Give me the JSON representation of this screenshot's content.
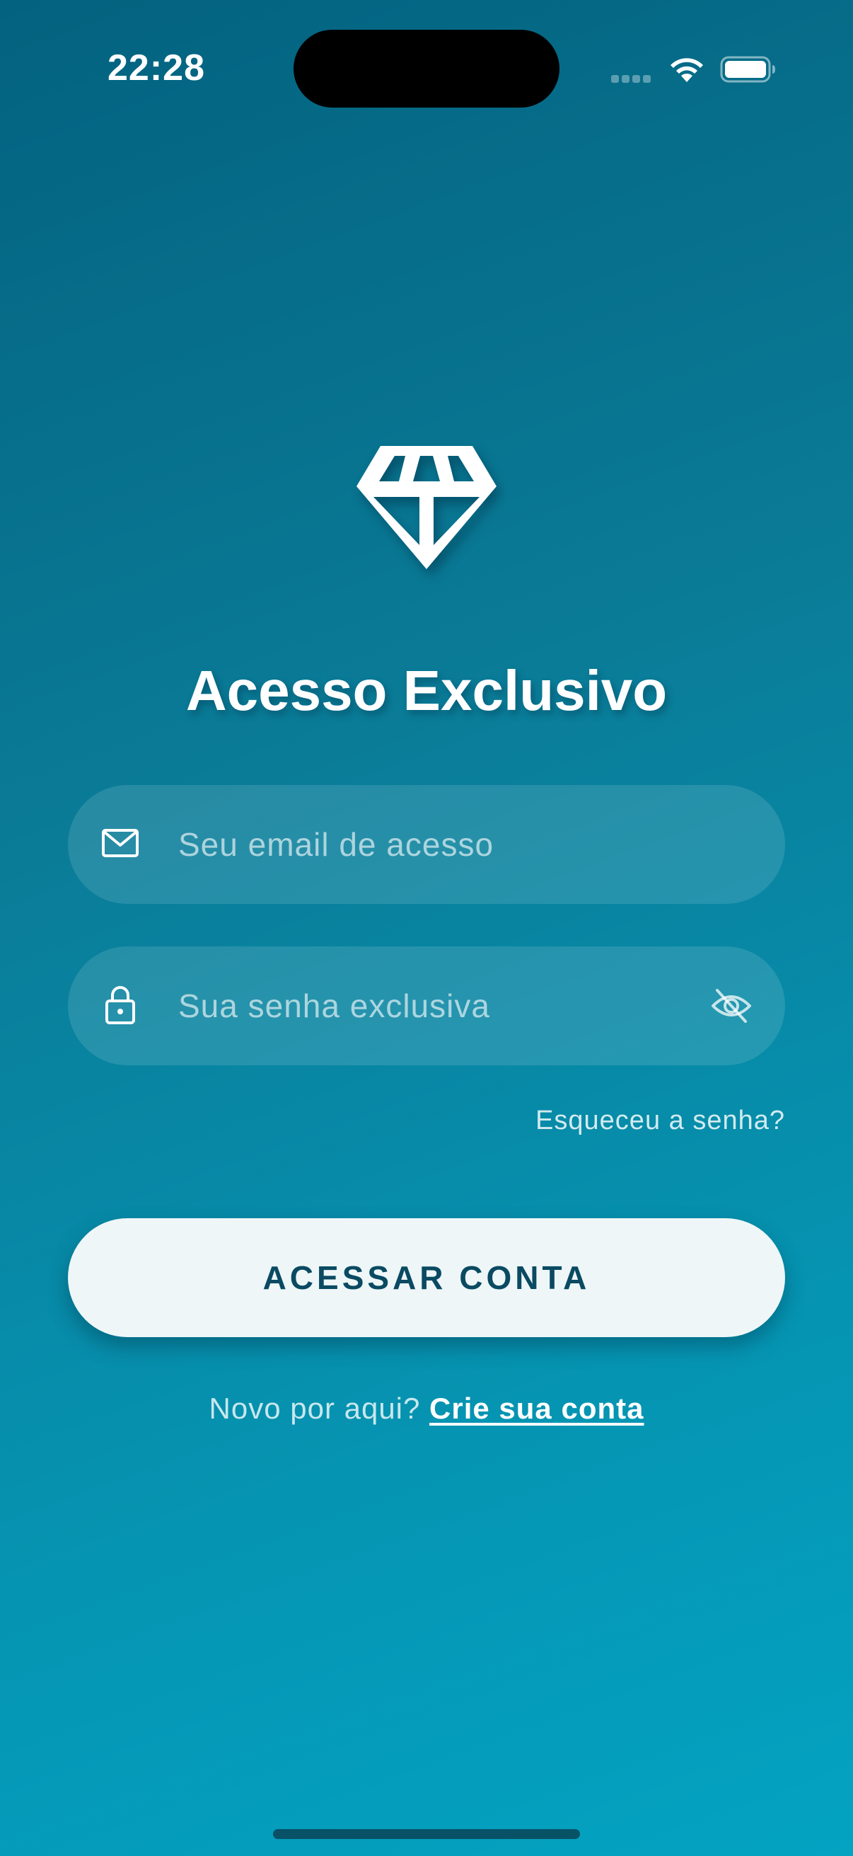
{
  "status_bar": {
    "time": "22:28",
    "icons": [
      "cellular-signal-icon",
      "wifi-icon",
      "battery-icon"
    ]
  },
  "logo": {
    "icon": "diamond-icon"
  },
  "title": "Acesso Exclusivo",
  "email_field": {
    "icon": "envelope-icon",
    "placeholder": "Seu email de acesso",
    "value": ""
  },
  "password_field": {
    "icon": "lock-icon",
    "placeholder": "Sua senha exclusiva",
    "value": "",
    "toggle_icon": "eye-off-icon"
  },
  "forgot_password": "Esqueceu a senha?",
  "submit_button": "ACESSAR CONTA",
  "signup": {
    "prompt": "Novo por aqui?",
    "link": "Crie sua conta"
  },
  "colors": {
    "background_top": "#03627f",
    "background_bottom": "#04a3c2",
    "button_background": "#eef6f8",
    "button_text": "#0a4a62"
  }
}
